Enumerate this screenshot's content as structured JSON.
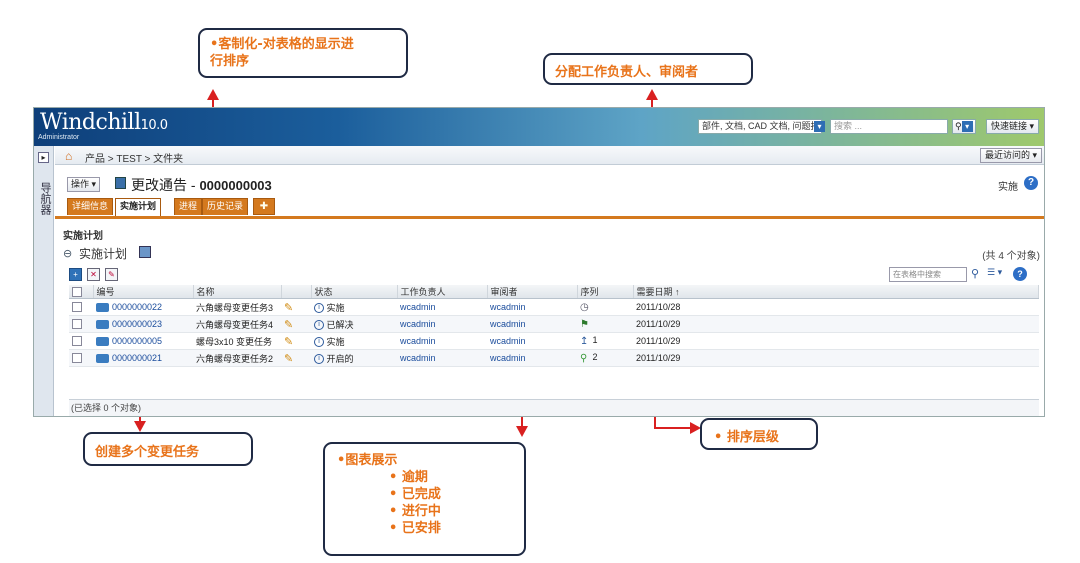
{
  "callouts": {
    "customize": {
      "line1": "客制化-对表格的显示进",
      "line2": "行排序"
    },
    "assign": {
      "text": "分配工作负责人、审阅者"
    },
    "create": {
      "text": "创建多个变更任务"
    },
    "chart": {
      "title": "图表展示",
      "items": [
        "逾期",
        "已完成",
        "进行中",
        "已安排"
      ]
    },
    "order": {
      "text": "排序层级"
    }
  },
  "header": {
    "logo": "Windchill",
    "version": "10.0",
    "user": "Administrator",
    "search_scope": "部件, 文档, CAD 文档, 问题报",
    "search_placeholder": "搜索 ...",
    "quick_links": "快速链接"
  },
  "nav": {
    "label": "导航器"
  },
  "breadcrumb": {
    "text": "产品 > TEST > 文件夹",
    "recent": "最近访问的"
  },
  "page": {
    "actions": "操作",
    "title": "更改通告 - ",
    "number": "0000000003",
    "state": "实施"
  },
  "tabs": [
    "详细信息",
    "实施计划",
    "进程",
    "历史记录"
  ],
  "section": {
    "title": "实施计划",
    "table_title": "实施计划",
    "count": "(共 4 个对象)"
  },
  "table": {
    "search_placeholder": "在表格中搜索",
    "columns": [
      "编号",
      "名称",
      "状态",
      "工作负责人",
      "审阅者",
      "序列",
      "需要日期"
    ],
    "rows": [
      {
        "number": "0000000022",
        "name": "六角螺母变更任务3",
        "status": "实施",
        "owner": "wcadmin",
        "reviewer": "wcadmin",
        "seq": "",
        "seq_icon": "clock-icon",
        "date": "2011/10/28"
      },
      {
        "number": "0000000023",
        "name": "六角螺母变更任务4",
        "status": "已解决",
        "owner": "wcadmin",
        "reviewer": "wcadmin",
        "seq": "",
        "seq_icon": "completed-icon",
        "date": "2011/10/29"
      },
      {
        "number": "0000000005",
        "name": "螺母3x10 变更任务",
        "status": "实施",
        "owner": "wcadmin",
        "reviewer": "wcadmin",
        "seq": "1",
        "seq_icon": "in-progress-icon",
        "date": "2011/10/29"
      },
      {
        "number": "0000000021",
        "name": "六角螺母变更任务2",
        "status": "开启的",
        "owner": "wcadmin",
        "reviewer": "wcadmin",
        "seq": "2",
        "seq_icon": "scheduled-icon",
        "date": "2011/10/29"
      }
    ],
    "footer": "(已选择 0 个对象)"
  }
}
